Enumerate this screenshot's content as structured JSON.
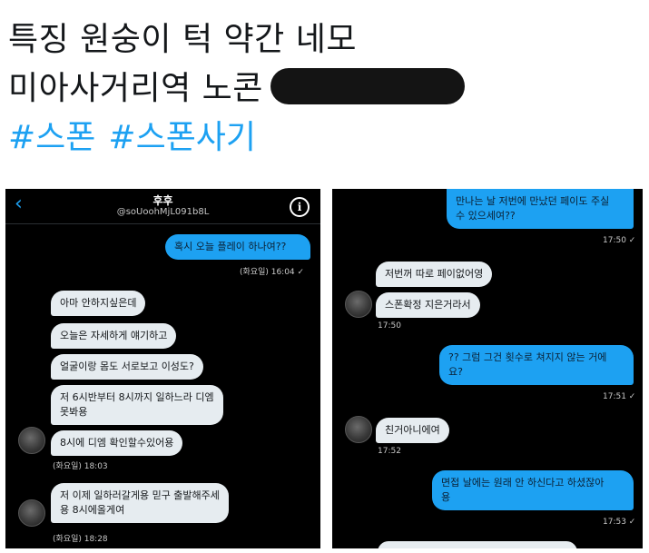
{
  "tweet": {
    "line1": "특징 원숭이 턱 약간 네모",
    "line2": "미아사거리역 노콘",
    "hashtags": [
      "#스폰",
      "#스폰사기"
    ]
  },
  "left_chat": {
    "name": "후후",
    "handle": "@soUoohMjL091b8L",
    "messages": [
      {
        "dir": "out",
        "text": "혹시 오늘 플레이 하나여??",
        "meta": "(화요일) 16:04 ✓"
      },
      {
        "dir": "in",
        "text": "아마 안하지싶은데"
      },
      {
        "dir": "in",
        "text": "오늘은 자세하게 얘기하고"
      },
      {
        "dir": "in",
        "text": "얼굴이랑 몸도 서로보고 이성도?"
      },
      {
        "dir": "in",
        "lines": [
          "저 6시반부터 8시까지 일하느라 디엠",
          "못봐용"
        ]
      },
      {
        "dir": "in",
        "text": "8시에 디엠 확인할수있어용",
        "meta": "(화요일) 18:03"
      },
      {
        "dir": "in",
        "lines": [
          "저 이제 일하러갈게용 믿구 출발해주세",
          "용 8시에올게여"
        ],
        "meta": "(화요일) 18:28"
      }
    ]
  },
  "right_chat": {
    "messages": [
      {
        "dir": "out",
        "lines": [
          "만나는 날 저번에 만났던 페이도 주실",
          "수 있으세여??"
        ],
        "meta": "17:50 ✓"
      },
      {
        "dir": "in",
        "text": "저번꺼 따로 페이없어영"
      },
      {
        "dir": "in",
        "text": "스폰확정 지은거라서",
        "meta": "17:50"
      },
      {
        "dir": "out",
        "lines": [
          "?? 그럼 그건 횟수로 쳐지지 않는 거에",
          "요?"
        ],
        "meta": "17:51 ✓"
      },
      {
        "dir": "in",
        "text": "친거아니에여",
        "meta": "17:52"
      },
      {
        "dir": "out",
        "lines": [
          "면접 날에는 원래 안 하신다고 하셨잖아",
          "용"
        ],
        "meta": "17:53 ✓"
      }
    ]
  }
}
